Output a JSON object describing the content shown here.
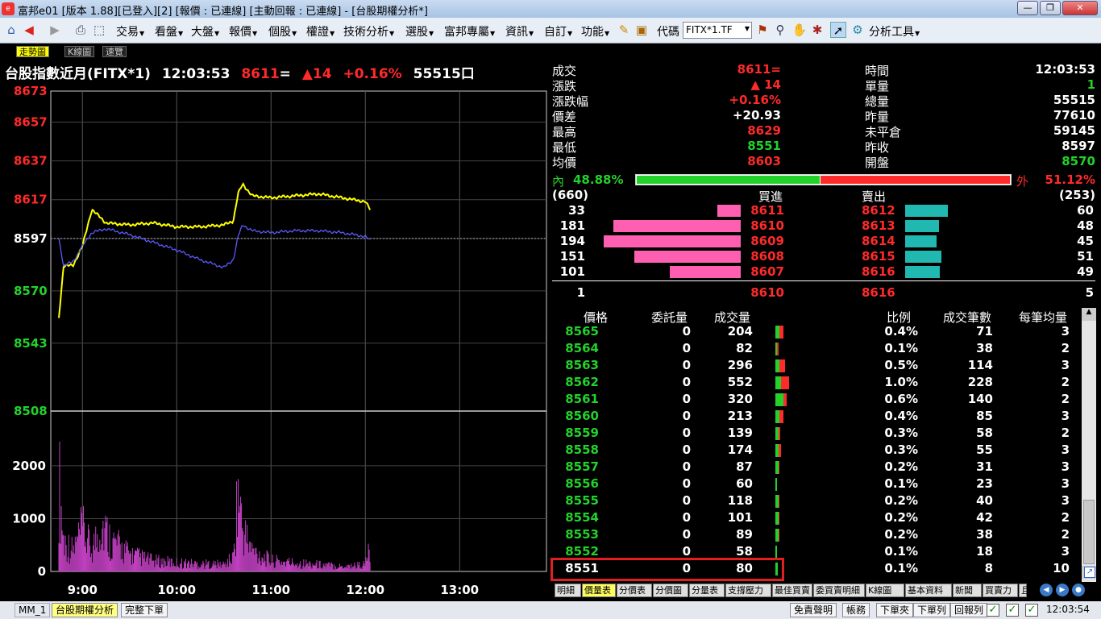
{
  "window": {
    "title": "富邦e01 [版本 1.88][已登入][2] [報價 : 已連線] [主動回報 : 已連線] - [台股期權分析*]",
    "min": "—",
    "max": "❐",
    "close": "✕"
  },
  "toolbar": {
    "menus": [
      "交易",
      "看盤",
      "大盤",
      "報價",
      "個股",
      "權證",
      "技術分析",
      "選股",
      "富邦專屬",
      "資訊",
      "自訂",
      "功能"
    ],
    "code_label": "代碼",
    "code_value": "FITX*1.TF",
    "analysis_tools": "分析工具"
  },
  "tabs": [
    "走勢圖",
    "K線圖",
    "速覽"
  ],
  "header": {
    "name": "台股指數近月(FITX*1)",
    "time": "12:03:53",
    "price": "8611",
    "price_suffix": "=",
    "change": "▲14",
    "change_pct": "+0.16%",
    "volume": "55515口"
  },
  "chart_data": {
    "type": "line",
    "price_axis": [
      "8673",
      "8657",
      "8637",
      "8617",
      "8597",
      "8570",
      "8543",
      "8508"
    ],
    "price_axis_colors": [
      "red",
      "red",
      "red",
      "red",
      "white",
      "green",
      "green",
      "green"
    ],
    "volume_axis": [
      "2000",
      "1000",
      "0"
    ],
    "time_axis": [
      "9:00",
      "10:00",
      "11:00",
      "12:00",
      "13:00"
    ],
    "reference": 8597,
    "series": [
      {
        "color": "#ffff00",
        "x": [
          8.75,
          8.8,
          8.9,
          9.0,
          9.1,
          9.25,
          9.5,
          9.75,
          10.0,
          10.25,
          10.5,
          10.6,
          10.65,
          10.7,
          10.8,
          11.0,
          11.25,
          11.5,
          11.75,
          12.0,
          12.05
        ],
        "values": [
          8556,
          8583,
          8583,
          8593,
          8612,
          8605,
          8604,
          8605,
          8603,
          8603,
          8604,
          8606,
          8620,
          8625,
          8619,
          8618,
          8619,
          8620,
          8618,
          8616,
          8612
        ]
      },
      {
        "color": "#5a5aff",
        "x": [
          8.75,
          8.8,
          8.9,
          9.0,
          9.1,
          9.25,
          9.5,
          9.75,
          10.0,
          10.25,
          10.5,
          10.6,
          10.65,
          10.7,
          10.8,
          11.0,
          11.25,
          11.5,
          11.75,
          12.0,
          12.05
        ],
        "values": [
          8597,
          8583,
          8585,
          8593,
          8600,
          8602,
          8599,
          8595,
          8591,
          8586,
          8582,
          8586,
          8598,
          8604,
          8601,
          8600,
          8601,
          8601,
          8600,
          8598,
          8596
        ]
      },
      {
        "color": "#c040c0",
        "name": "volume",
        "x": [
          8.75,
          8.8,
          8.9,
          9.0,
          9.1,
          9.2,
          9.3,
          9.5,
          9.75,
          10.0,
          10.25,
          10.5,
          10.6,
          10.65,
          10.7,
          10.8,
          11.0,
          11.25,
          11.5,
          11.75,
          12.0,
          12.05
        ],
        "values": [
          2700,
          900,
          600,
          1200,
          600,
          1400,
          900,
          500,
          300,
          250,
          220,
          200,
          400,
          2300,
          1200,
          600,
          300,
          250,
          200,
          150,
          200,
          700
        ]
      }
    ]
  },
  "quote": {
    "left": [
      {
        "label": "成交",
        "value": "8611=",
        "color": "red"
      },
      {
        "label": "漲跌",
        "value": "▲ 14",
        "color": "red"
      },
      {
        "label": "漲跌幅",
        "value": "+0.16%",
        "color": "red"
      },
      {
        "label": "價差",
        "value": "+20.93",
        "color": "white"
      },
      {
        "label": "最高",
        "value": "8629",
        "color": "red"
      },
      {
        "label": "最低",
        "value": "8551",
        "color": "green"
      },
      {
        "label": "均價",
        "value": "8603",
        "color": "red"
      }
    ],
    "right": [
      {
        "label": "時間",
        "value": "12:03:53",
        "color": "white"
      },
      {
        "label": "單量",
        "value": "1",
        "color": "green"
      },
      {
        "label": "總量",
        "value": "55515",
        "color": "white"
      },
      {
        "label": "昨量",
        "value": "77610",
        "color": "white"
      },
      {
        "label": "未平倉",
        "value": "59145",
        "color": "white"
      },
      {
        "label": "昨收",
        "value": "8597",
        "color": "white"
      },
      {
        "label": "開盤",
        "value": "8570",
        "color": "green"
      }
    ]
  },
  "inout": {
    "in_label": "內",
    "in_pct": "48.88%",
    "in_frac": 0.4888,
    "out_label": "外",
    "out_pct": "51.12%"
  },
  "depth": {
    "bid_total": "(660)",
    "bid_header": "買進",
    "ask_header": "賣出",
    "ask_total": "(253)",
    "rows": [
      {
        "bid_qty": "33",
        "bid_price": "8611",
        "ask_price": "8612",
        "ask_qty": "60"
      },
      {
        "bid_qty": "181",
        "bid_price": "8610",
        "ask_price": "8613",
        "ask_qty": "48"
      },
      {
        "bid_qty": "194",
        "bid_price": "8609",
        "ask_price": "8614",
        "ask_qty": "45"
      },
      {
        "bid_qty": "151",
        "bid_price": "8608",
        "ask_price": "8615",
        "ask_qty": "51"
      },
      {
        "bid_qty": "101",
        "bid_price": "8607",
        "ask_price": "8616",
        "ask_qty": "49"
      }
    ],
    "summary": {
      "left": "1",
      "bid": "8610",
      "ask": "8616",
      "right": "5"
    }
  },
  "volume_table": {
    "headers": [
      "價格",
      "委託量",
      "成交量",
      "比例",
      "成交筆數",
      "每筆均量"
    ],
    "rows": [
      {
        "price": "8565",
        "pending": "0",
        "vol": "204",
        "ratio": "0.4%",
        "trades": "71",
        "avg": "3",
        "g": 0.4,
        "r": 0.4
      },
      {
        "price": "8564",
        "pending": "0",
        "vol": "82",
        "ratio": "0.1%",
        "trades": "38",
        "avg": "2",
        "g": 0.15,
        "r": 0.15
      },
      {
        "price": "8563",
        "pending": "0",
        "vol": "296",
        "ratio": "0.5%",
        "trades": "114",
        "avg": "3",
        "g": 0.4,
        "r": 0.6
      },
      {
        "price": "8562",
        "pending": "0",
        "vol": "552",
        "ratio": "1.0%",
        "trades": "228",
        "avg": "2",
        "g": 0.6,
        "r": 0.8
      },
      {
        "price": "8561",
        "pending": "0",
        "vol": "320",
        "ratio": "0.6%",
        "trades": "140",
        "avg": "2",
        "g": 0.8,
        "r": 0.3
      },
      {
        "price": "8560",
        "pending": "0",
        "vol": "213",
        "ratio": "0.4%",
        "trades": "85",
        "avg": "3",
        "g": 0.4,
        "r": 0.4
      },
      {
        "price": "8559",
        "pending": "0",
        "vol": "139",
        "ratio": "0.3%",
        "trades": "58",
        "avg": "2",
        "g": 0.35,
        "r": 0.2
      },
      {
        "price": "8558",
        "pending": "0",
        "vol": "174",
        "ratio": "0.3%",
        "trades": "55",
        "avg": "3",
        "g": 0.35,
        "r": 0.25
      },
      {
        "price": "8557",
        "pending": "0",
        "vol": "87",
        "ratio": "0.2%",
        "trades": "31",
        "avg": "3",
        "g": 0.3,
        "r": 0.05
      },
      {
        "price": "8556",
        "pending": "0",
        "vol": "60",
        "ratio": "0.1%",
        "trades": "23",
        "avg": "3",
        "g": 0.2,
        "r": 0.0
      },
      {
        "price": "8555",
        "pending": "0",
        "vol": "118",
        "ratio": "0.2%",
        "trades": "40",
        "avg": "3",
        "g": 0.3,
        "r": 0.1
      },
      {
        "price": "8554",
        "pending": "0",
        "vol": "101",
        "ratio": "0.2%",
        "trades": "42",
        "avg": "2",
        "g": 0.3,
        "r": 0.05
      },
      {
        "price": "8553",
        "pending": "0",
        "vol": "89",
        "ratio": "0.2%",
        "trades": "38",
        "avg": "2",
        "g": 0.3,
        "r": 0.05
      },
      {
        "price": "8552",
        "pending": "0",
        "vol": "58",
        "ratio": "0.1%",
        "trades": "18",
        "avg": "3",
        "g": 0.2,
        "r": 0.0
      },
      {
        "price": "8551",
        "pending": "0",
        "vol": "80",
        "ratio": "0.1%",
        "trades": "8",
        "avg": "10",
        "g": 0.25,
        "r": 0.0
      }
    ]
  },
  "bottom_tabs": [
    "明細",
    "價量表",
    "分價表",
    "分價圖",
    "分量表",
    "支撐壓力",
    "最佳買賣",
    "委買賣明細",
    "K線圖",
    "基本資料",
    "新聞",
    "買賣力",
    "且"
  ],
  "statusbar": {
    "tabs": [
      "MM_1",
      "台股期權分析",
      "完整下單"
    ],
    "buttons": [
      "免責聲明",
      "帳務",
      "下單夾",
      "下單列",
      "回報列"
    ],
    "time": "12:03:54"
  },
  "colors": {
    "red": "#ff2a2a",
    "green": "#22d22a",
    "yellow": "#ffff00",
    "bid_bar": "#ff5fb0",
    "ask_bar": "#20b8b0",
    "highlight": "#e02020"
  }
}
